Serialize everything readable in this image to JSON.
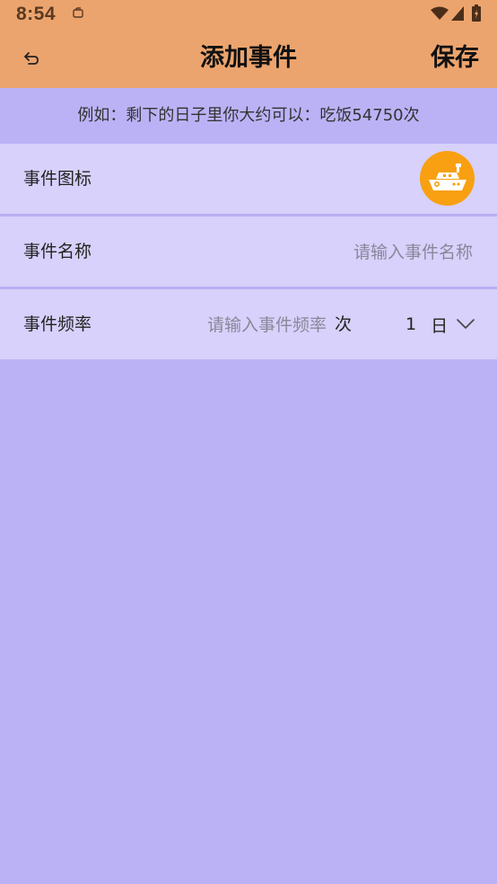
{
  "status_bar": {
    "time": "8:54"
  },
  "header": {
    "title": "添加事件",
    "save_label": "保存"
  },
  "hint": "例如：剩下的日子里你大约可以：吃饭54750次",
  "fields": {
    "icon": {
      "label": "事件图标",
      "icon_name": "ship-icon",
      "color": "#f8a012"
    },
    "name": {
      "label": "事件名称",
      "value": "",
      "placeholder": "请输入事件名称"
    },
    "frequency": {
      "label": "事件频率",
      "value": "",
      "placeholder": "请输入事件频率",
      "unit": "次",
      "period_count": "1",
      "period_unit": "日"
    }
  },
  "colors": {
    "header": "#eca46e",
    "background": "#bbb2f6",
    "row": "#d7d1fb",
    "accent": "#f8a012"
  }
}
